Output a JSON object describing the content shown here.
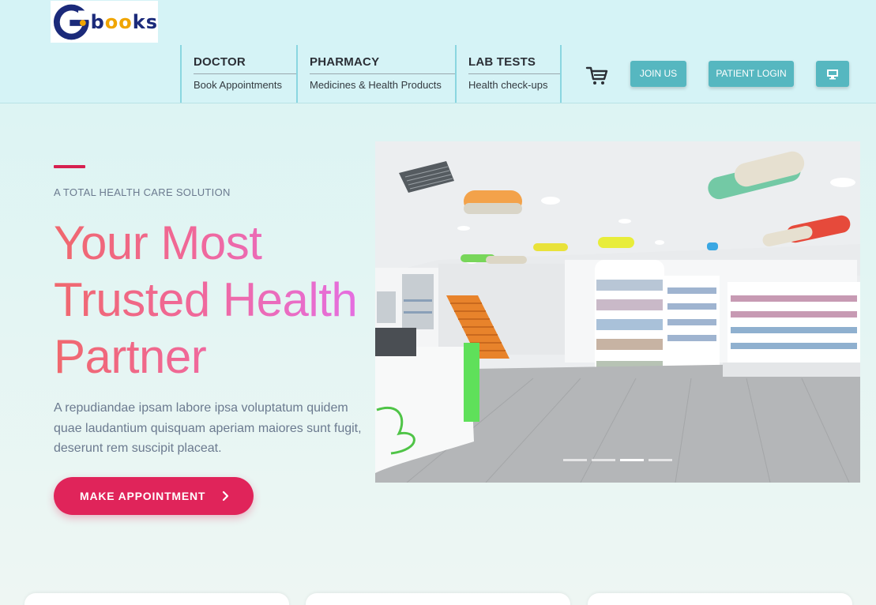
{
  "brand": {
    "logo_letter": "G",
    "logo_text": "books"
  },
  "nav": [
    {
      "title": "DOCTOR",
      "subtitle": "Book Appointments"
    },
    {
      "title": "PHARMACY",
      "subtitle": "Medicines & Health Products"
    },
    {
      "title": "LAB TESTS",
      "subtitle": "Health check-ups"
    }
  ],
  "header_actions": {
    "cart_icon": "shopping-cart-icon",
    "join_label": "JOIN US",
    "patient_login_label": "PATIENT LOGIN",
    "monitor_icon": "desktop-monitor-icon"
  },
  "hero": {
    "kicker": "A TOTAL HEALTH CARE SOLUTION",
    "headline_line1": "Your Most",
    "headline_line2": "Trusted Health",
    "headline_line3": "Partner",
    "description": "A repudiandae ipsam labore ipsa voluptatum quidem quae laudantium quisquam aperiam maiores sunt fugit, deserunt rem suscipit placeat.",
    "cta_label": "MAKE APPOINTMENT",
    "cta_icon": "chevron-right-icon"
  },
  "carousel": {
    "slides": 4,
    "active_slide": 3
  },
  "colors": {
    "accent": "#e0245a",
    "teal": "#56b7c0",
    "header_bg": "#d5f3f6"
  }
}
